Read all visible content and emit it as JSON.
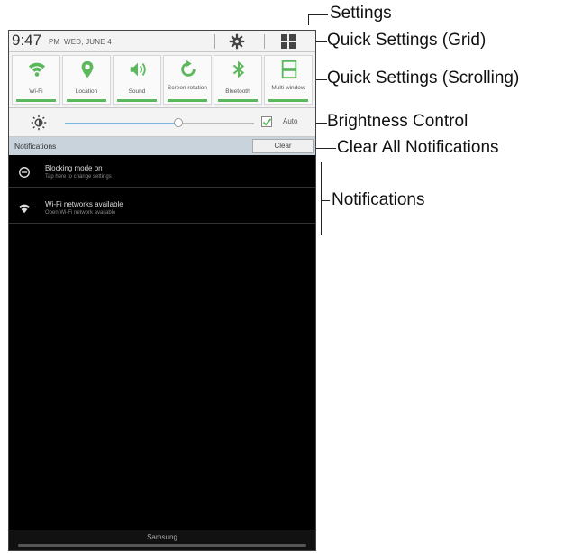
{
  "status_bar": {
    "time": "9:47",
    "ampm": "PM",
    "date": "WED, JUNE 4"
  },
  "quick_tiles": [
    {
      "label": "Wi-Fi",
      "icon": "wifi-icon"
    },
    {
      "label": "Location",
      "icon": "location-pin-icon"
    },
    {
      "label": "Sound",
      "icon": "sound-icon"
    },
    {
      "label": "Screen rotation",
      "icon": "rotation-icon"
    },
    {
      "label": "Bluetooth",
      "icon": "bluetooth-icon"
    },
    {
      "label": "Multi window",
      "icon": "multi-window-icon"
    }
  ],
  "brightness": {
    "level": 0.6,
    "auto_label": "Auto",
    "auto_checked": true
  },
  "notifications": {
    "header": "Notifications",
    "clear_label": "Clear",
    "items": [
      {
        "title": "Blocking mode on",
        "subtitle": "Tap here to change settings",
        "icon": "blocking-mode-icon"
      },
      {
        "title": "Wi-Fi networks available",
        "subtitle": "Open Wi-Fi network available",
        "icon": "wifi-icon"
      }
    ]
  },
  "carrier": "Samsung",
  "callouts": {
    "settings": "Settings",
    "quick_grid": "Quick Settings (Grid)",
    "quick_scroll": "Quick Settings (Scrolling)",
    "brightness": "Brightness Control",
    "clear_all": "Clear All Notifications",
    "notifications": "Notifications"
  },
  "colors": {
    "accent_green": "#5cb85c",
    "header_blue": "#c8d3dc"
  }
}
